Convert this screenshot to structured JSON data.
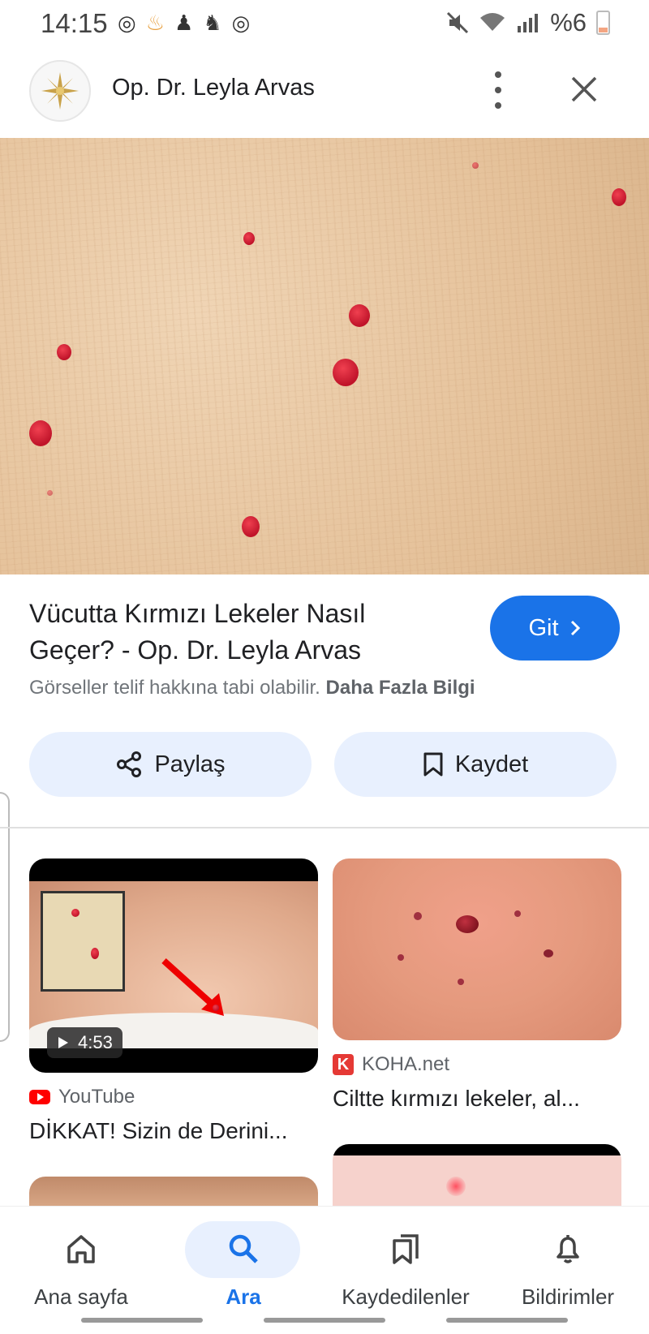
{
  "status_bar": {
    "time": "14:15",
    "battery": "%6"
  },
  "header": {
    "site_name": "Op. Dr. Leyla Arvas"
  },
  "result": {
    "title": "Vücutta Kırmızı Lekeler Nasıl Geçer? - Op. Dr. Leyla Arvas",
    "go_label": "Git",
    "copyright_text": "Görseller telif hakkına tabi olabilir.",
    "more_info_label": "Daha Fazla Bilgi",
    "share_label": "Paylaş",
    "save_label": "Kaydet"
  },
  "related": [
    {
      "source": "YouTube",
      "title": "DİKKAT! Sizin de Derini...",
      "duration": "4:53"
    },
    {
      "source": "KOHA.net",
      "title": "Ciltte kırmızı lekeler, al..."
    }
  ],
  "bottom_nav": {
    "home": "Ana sayfa",
    "search": "Ara",
    "saved": "Kaydedilenler",
    "notifications": "Bildirimler"
  },
  "colors": {
    "accent": "#1a73e8",
    "chip_bg": "#e8f0fe"
  }
}
